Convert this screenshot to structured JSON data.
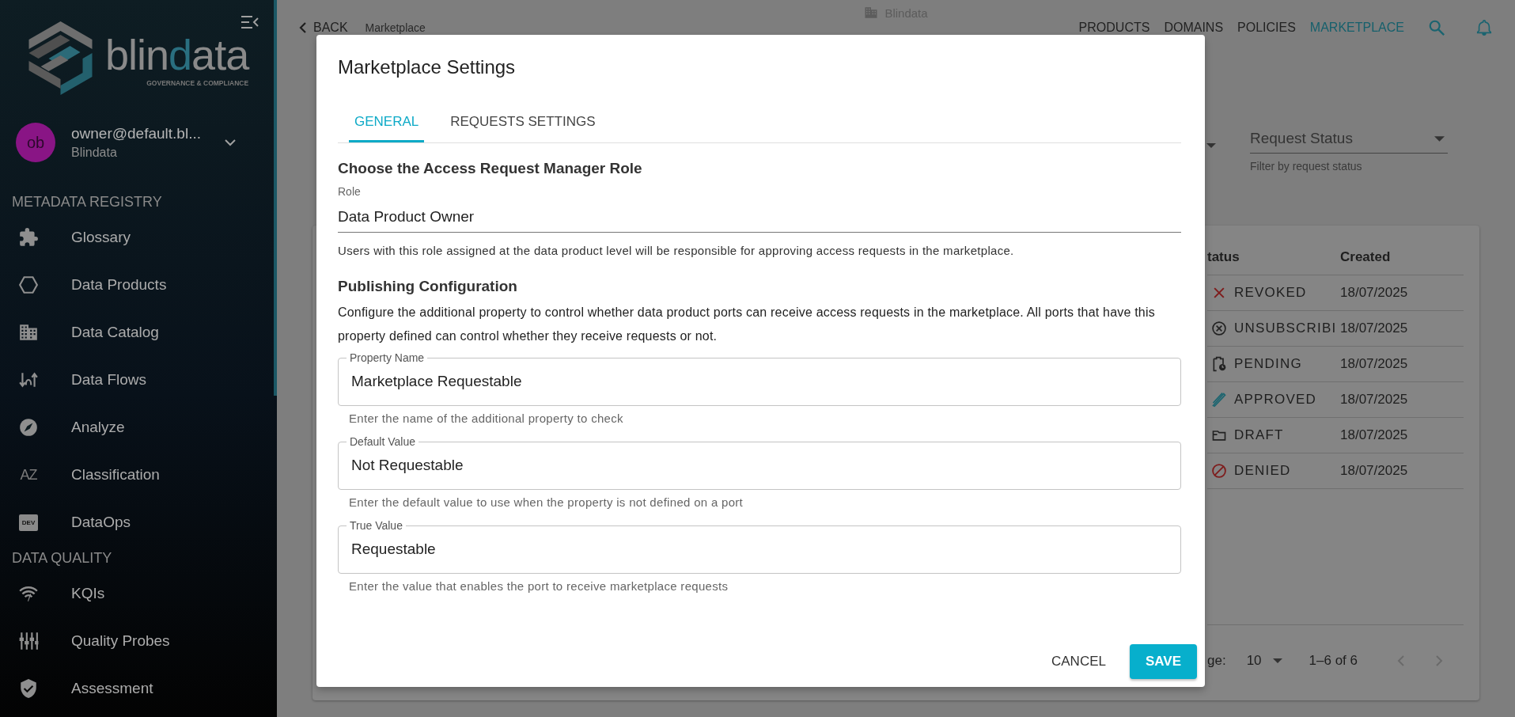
{
  "sidebar": {
    "logo": {
      "wordmark": [
        {
          "text": "blin",
          "accent": false
        },
        {
          "text": "d",
          "accent": true
        },
        {
          "text": "ata",
          "accent": false
        }
      ],
      "tagline": "GOVERNANCE & COMPLIANCE"
    },
    "user": {
      "initials": "ob",
      "email": "owner@default.bl...",
      "org": "Blindata"
    },
    "sections": [
      {
        "title": "METADATA REGISTRY",
        "items": [
          {
            "label": "Glossary",
            "kind": "puzzle"
          },
          {
            "label": "Data Products",
            "kind": "hexagon"
          },
          {
            "label": "Data Catalog",
            "kind": "building"
          },
          {
            "label": "Data Flows",
            "kind": "flows"
          },
          {
            "label": "Analyze",
            "kind": "compass"
          },
          {
            "label": "Classification",
            "kind": "letters",
            "icon_text": "AZ"
          },
          {
            "label": "DataOps",
            "kind": "tag",
            "icon_text": "DEV"
          }
        ]
      },
      {
        "title": "DATA QUALITY",
        "items": [
          {
            "label": "KQIs",
            "kind": "gauge"
          },
          {
            "label": "Quality Probes",
            "kind": "sliders"
          },
          {
            "label": "Assessment",
            "kind": "shield"
          }
        ]
      }
    ]
  },
  "header": {
    "back": "BACK",
    "breadcrumb": "Marketplace",
    "tenant": "Blindata",
    "nav": [
      {
        "label": "PRODUCTS",
        "selected": false
      },
      {
        "label": "DOMAINS",
        "selected": false
      },
      {
        "label": "POLICIES",
        "selected": false
      },
      {
        "label": "MARKETPLACE",
        "selected": true
      }
    ]
  },
  "filter": {
    "label": "Request Status",
    "helper": "Filter by request status"
  },
  "table": {
    "columns": [
      "tatus",
      "Created"
    ],
    "rows": [
      {
        "status": "REVOKED",
        "kind": "revoked",
        "created": "18/07/2025"
      },
      {
        "status": "UNSUBSCRIBI",
        "kind": "unsubscribed",
        "created": "18/07/2025"
      },
      {
        "status": "PENDING",
        "kind": "pending",
        "created": "18/07/2025"
      },
      {
        "status": "APPROVED",
        "kind": "approved",
        "created": "18/07/2025"
      },
      {
        "status": "DRAFT",
        "kind": "draft",
        "created": "18/07/2025"
      },
      {
        "status": "DENIED",
        "kind": "denied",
        "created": "18/07/2025"
      }
    ]
  },
  "pagination": {
    "rows_label": "ge:",
    "rows_per_page": "10",
    "range": "1–6 of 6"
  },
  "dialog": {
    "title": "Marketplace Settings",
    "tabs": [
      {
        "label": "GENERAL",
        "selected": true
      },
      {
        "label": "REQUESTS SETTINGS",
        "selected": false
      }
    ],
    "role_section": {
      "heading": "Choose the Access Request Manager Role",
      "field_label": "Role",
      "value": "Data Product Owner",
      "helper": "Users with this role assigned at the data product level will be responsible for approving access requests in the marketplace."
    },
    "publishing": {
      "heading": "Publishing Configuration",
      "description": "Configure the additional property to control whether data product ports can receive access requests in the marketplace. All ports that have this property defined can control whether they receive requests or not.",
      "fields": [
        {
          "label": "Property Name",
          "value": "Marketplace Requestable",
          "helper": "Enter the name of the additional property to check"
        },
        {
          "label": "Default Value",
          "value": "Not Requestable",
          "helper": "Enter the default value to use when the property is not defined on a port"
        },
        {
          "label": "True Value",
          "value": "Requestable",
          "helper": "Enter the value that enables the port to receive marketplace requests"
        }
      ]
    },
    "actions": [
      {
        "label": "CANCEL",
        "kind": "text"
      },
      {
        "label": "SAVE",
        "kind": "primary"
      }
    ]
  }
}
